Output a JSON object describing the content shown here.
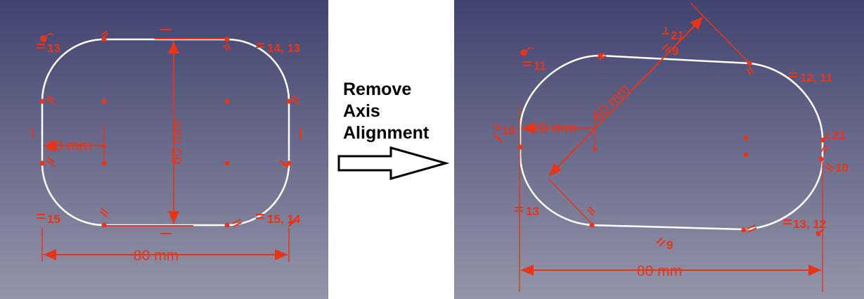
{
  "colors": {
    "constraint": "#e8351a",
    "sketch_line": "#ffffff",
    "background_top": "#414370",
    "background_bottom": "#9494a8"
  },
  "caption": [
    "Remove",
    "Axis",
    "Alignment"
  ],
  "left_sketch": {
    "constraint_labels": [
      "13",
      "14, 13",
      "15",
      "15, 14"
    ],
    "dimensions": {
      "width": "80 mm",
      "height": "60 mm",
      "radius": "20 mm"
    }
  },
  "right_sketch": {
    "constraint_labels": [
      "21",
      "9",
      "11",
      "12, 11",
      "10",
      "21",
      "10",
      "13",
      "13, 12",
      "9"
    ],
    "dimensions": {
      "width": "80 mm",
      "height": "60 mm",
      "radius": "20 mm"
    }
  }
}
